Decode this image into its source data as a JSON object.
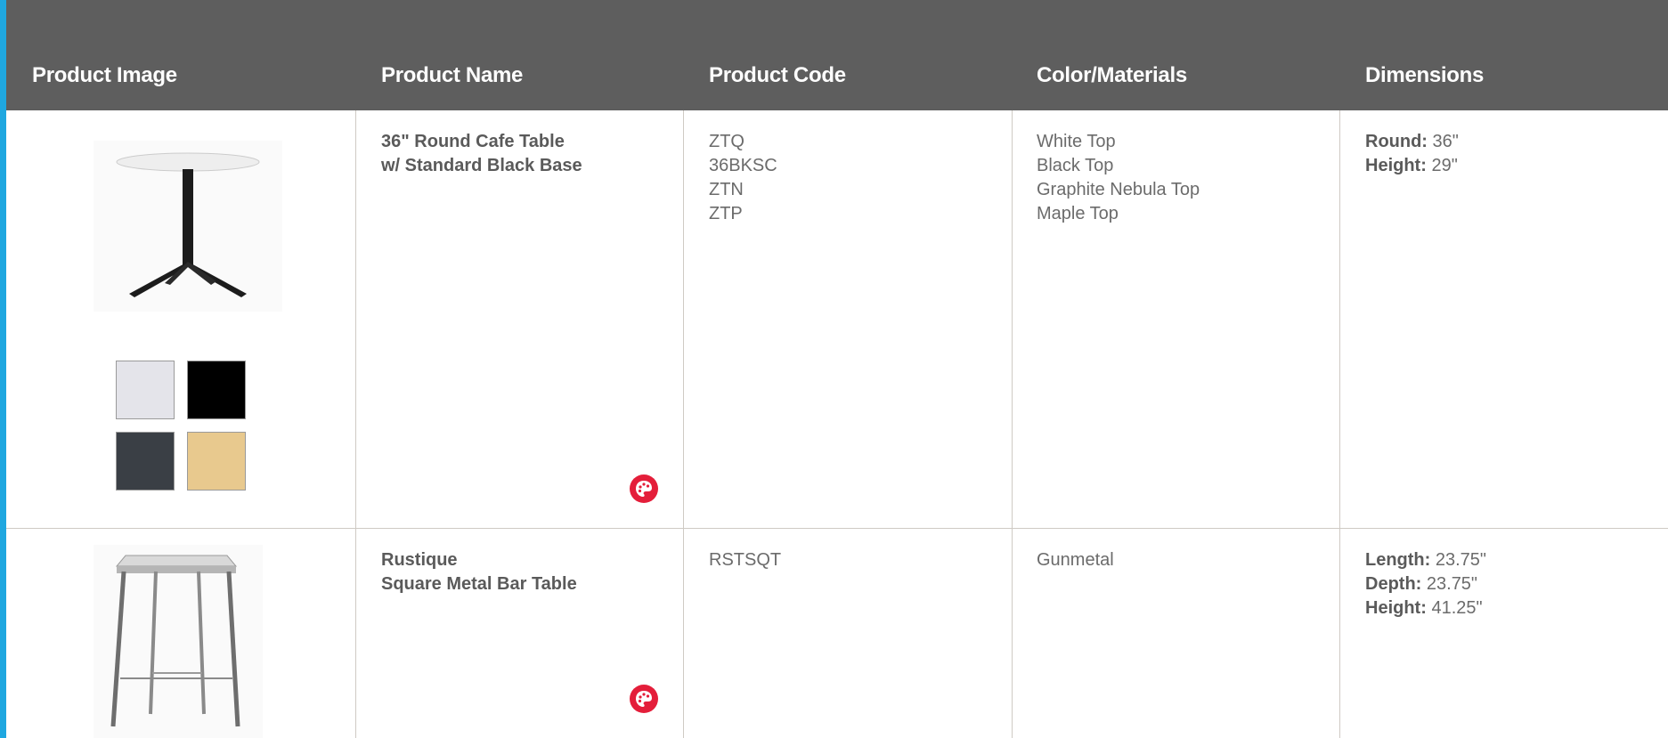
{
  "table": {
    "headers": {
      "image": "Product Image",
      "name": "Product Name",
      "code": "Product Code",
      "materials": "Color/Materials",
      "dimensions": "Dimensions"
    },
    "rows": [
      {
        "name_lines": [
          "36\" Round Cafe Table",
          "w/ Standard Black Base"
        ],
        "codes": [
          "ZTQ",
          "36BKSC",
          "ZTN",
          "ZTP"
        ],
        "materials": [
          "White Top",
          "Black Top",
          "Graphite Nebula Top",
          "Maple Top"
        ],
        "dimensions": [
          {
            "label": "Round:",
            "value": " 36\""
          },
          {
            "label": "Height:",
            "value": " 29\""
          }
        ],
        "swatches": [
          {
            "name": "white",
            "color": "#e4e4ea"
          },
          {
            "name": "black",
            "color": "#000000"
          },
          {
            "name": "graphite-nebula",
            "color": "#3a3f45"
          },
          {
            "name": "maple",
            "color": "#e8c98e"
          }
        ],
        "icon": "palette-icon"
      },
      {
        "name_lines": [
          "Rustique",
          "Square Metal Bar Table"
        ],
        "codes": [
          "RSTSQT"
        ],
        "materials": [
          "Gunmetal"
        ],
        "dimensions": [
          {
            "label": "Length:",
            "value": " 23.75\""
          },
          {
            "label": "Depth:",
            "value": " 23.75\""
          },
          {
            "label": "Height:",
            "value": " 41.25\""
          }
        ],
        "icon": "palette-icon"
      }
    ]
  },
  "colors": {
    "header_bg": "#5e5e5e",
    "accent_stripe": "#1fa7e0",
    "icon_red": "#e41e3a",
    "grid_line": "#cfcac4"
  }
}
